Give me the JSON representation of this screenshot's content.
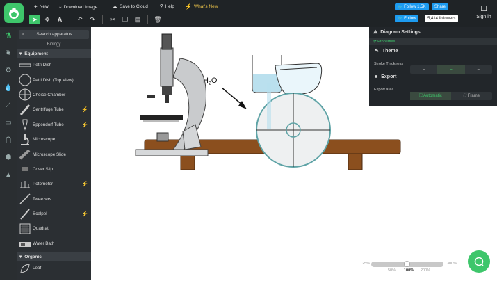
{
  "topbar": {
    "new_label": "New",
    "download_label": "Download Image",
    "save_label": "Save to Cloud",
    "help_label": "Help",
    "whats_new_label": "What's New",
    "follow_label": "Follow 1.5K",
    "share_label": "Share",
    "follow2_label": "Follow",
    "followers": "5,414 followers",
    "signin_label": "Sign in"
  },
  "panel": {
    "search_placeholder": "Search apparatus",
    "category": "Biology",
    "group1": "Equipment",
    "group2": "Organic",
    "items": [
      "Petri Dish",
      "Petri Dish (Top View)",
      "Choice Chamber",
      "Centrifuge Tube",
      "Eppendorf Tube",
      "Microscope",
      "Microscope Slide",
      "Cover Slip",
      "Potometer",
      "Tweezers",
      "Scalpel",
      "Quadrat",
      "Water Bath"
    ],
    "organic_items": [
      "Leaf"
    ]
  },
  "canvas": {
    "h2o_label": "H",
    "h2o_sub": "2",
    "h2o_tail": "O"
  },
  "settings": {
    "title": "Diagram Settings",
    "tab": "Properties",
    "theme_label": "Theme",
    "stroke_label": "Stroke Thickness",
    "export_label": "Export",
    "export_area_label": "Export area",
    "automatic_label": "Automatic",
    "frame_label": "Frame"
  },
  "zoom": {
    "min": "25%",
    "max": "300%",
    "ticks": [
      "50%",
      "100%",
      "200%"
    ]
  },
  "colors": {
    "accent": "#3ec66b",
    "bench": "#8b4f1e",
    "twitter": "#1d9bf0"
  }
}
